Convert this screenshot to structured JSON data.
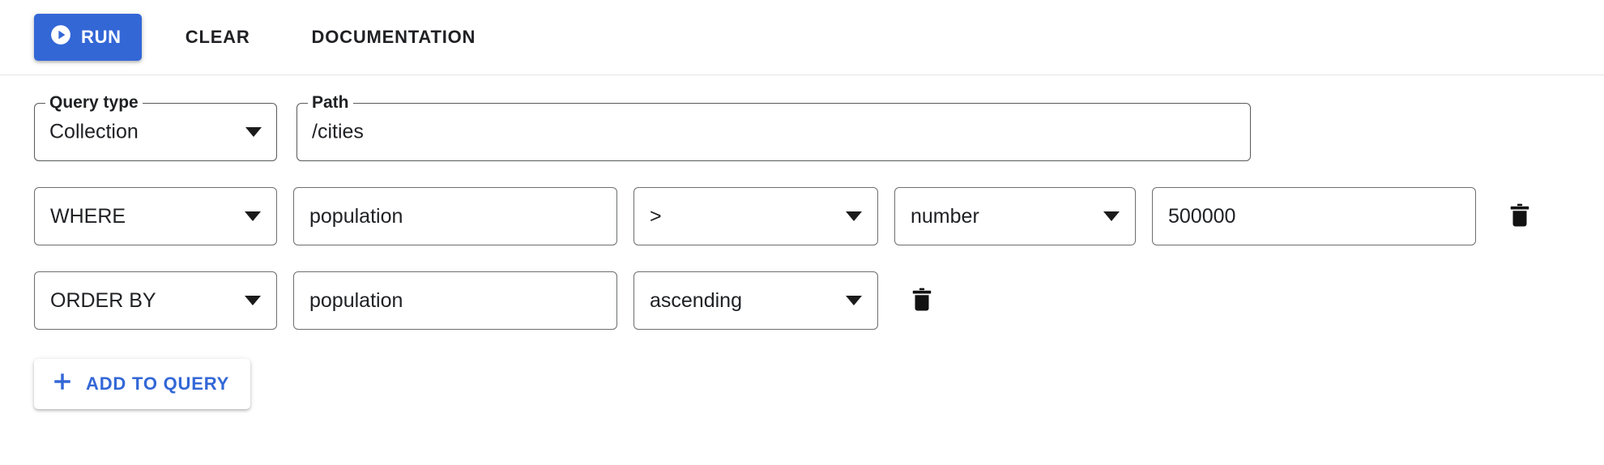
{
  "toolbar": {
    "run_label": "RUN",
    "run_icon": "play-circle-icon",
    "clear_label": "CLEAR",
    "documentation_label": "DOCUMENTATION",
    "accent_color": "#3367d6"
  },
  "query": {
    "query_type": {
      "label": "Query type",
      "value": "Collection",
      "icon": "chevron-down-icon"
    },
    "path": {
      "label": "Path",
      "value": "/cities",
      "placeholder": "/cities"
    },
    "clauses": [
      {
        "keyword": "WHERE",
        "field": "population",
        "operator": ">",
        "value_type": "number",
        "value": "500000",
        "delete_icon": "trash-icon"
      },
      {
        "keyword": "ORDER BY",
        "field": "population",
        "direction": "ascending",
        "delete_icon": "trash-icon"
      }
    ],
    "add_button": {
      "label": "ADD TO QUERY",
      "icon": "plus-icon"
    }
  }
}
